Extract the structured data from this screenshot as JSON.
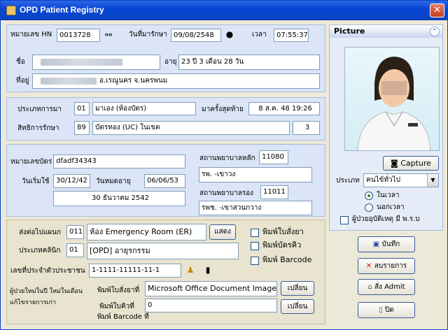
{
  "window": {
    "title": "OPD Patient Registry",
    "close_glyph": "✕"
  },
  "visit": {
    "hn_label": "หมายเลข HN",
    "hn": "0013728",
    "date_label": "วันที่มารักษา",
    "date": "09/08/2548",
    "time_label": "เวลา",
    "time": "07:55:37",
    "name_label": "ชื่อ",
    "age_label": "อายุ",
    "age": "23 ปี 3 เดือน 28 วัน",
    "address_label": "ที่อยู่",
    "address": "อ.เรณูนคร จ.นครพนม"
  },
  "arrival": {
    "type_label": "ประเภทการมา",
    "type_code": "01",
    "type_name": "มาเอง (ห้องบัตร)",
    "last_visit_label": "มาครั้งสุดท้าย",
    "last_visit": "8 ส.ค. 48 19:26",
    "right_label": "สิทธิการรักษา",
    "right_code": "89",
    "right_name": "บัตรทอง (UC) ในเขต",
    "right_extra": "3"
  },
  "card": {
    "card_no_label": "หมายเลขบัตร",
    "card_no": "dfadf34343",
    "start_label": "วันเริ่มใช้",
    "start": "30/12/42",
    "expire_label": "วันหมดอายุ",
    "expire": "06/06/53",
    "start_long": "30 ธันวาคม 2542",
    "main_hosp_label": "สถานพยาบาลหลัก",
    "main_hosp_code": "11080",
    "main_hosp_name": "รพ. -เขาวง",
    "sub_hosp_label": "สถานพยาบาลรอง",
    "sub_hosp_code": "11011",
    "sub_hosp_name": "รพช. -เขาสวนกวาง"
  },
  "referral": {
    "send_label": "ส่งต่อไปแผนก",
    "send_code": "011",
    "send_name": "ห้อง Emergency Room (ER)",
    "show_button": "แสดง",
    "clinic_label": "ประเภทคลินิก",
    "clinic_code": "01",
    "clinic_name": "[OPD] อายุรกรรม",
    "pid_label": "เลขที่ประจำตัวประชาชน",
    "pid": "1-1111-11111-11-1",
    "print_slip": "พิมพ์ใบสั่งยา",
    "print_queue": "พิมพ์บัตรคิว",
    "print_barcode": "พิมพ์ Barcode",
    "new_patient_label": "ผู้ป่วยใหม่ในปี ใหม่ในเดือน",
    "edit_old_label": "แก้ไขรายการเก่า",
    "slip_printer_label": "พิมพ์ใบสั่งยาที่",
    "slip_printer": "Microsoft Office Document Image W",
    "queue_printer_label": "พิมพ์ใบคิวที่",
    "queue_printer": "0",
    "barcode_printer_label": "พิมพ์ Barcode ที่",
    "change_button": "เปลี่ยน"
  },
  "picture": {
    "header": "Picture",
    "capture": "Capture",
    "type_label": "ประเภท",
    "type_value": "คนไข้ทั่วไป",
    "in_hours": "ในเวลา",
    "out_hours": "นอกเวลา",
    "accident": "ผู้ป่วยอุบัติเหตุ มี พ.ร.บ"
  },
  "actions": {
    "save": "บันทึก",
    "delete": "ลบรายการ",
    "admit": "สั่ง Admit",
    "close": "ปิด"
  },
  "colors": {
    "titlebar": "#0a46d6",
    "panel_blue": "#dbe5f7",
    "panel_tan": "#e8e4cf",
    "window_bg": "#ece9d8"
  }
}
